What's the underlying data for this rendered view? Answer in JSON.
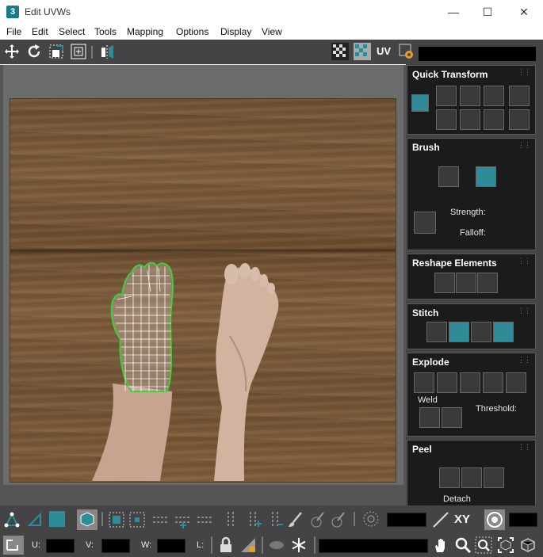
{
  "window": {
    "app_icon_text": "3",
    "title": "Edit UVWs",
    "minimize": "—",
    "maximize": "☐",
    "close": "✕"
  },
  "menu": [
    "File",
    "Edit",
    "Select",
    "Tools",
    "Mapping",
    "Options",
    "Display",
    "View"
  ],
  "toolbar": {
    "uv_label": "UV"
  },
  "panel": {
    "quick_transform": {
      "title": "Quick Transform"
    },
    "brush": {
      "title": "Brush",
      "strength_label": "Strength:",
      "falloff_label": "Falloff:"
    },
    "reshape": {
      "title": "Reshape Elements"
    },
    "stitch": {
      "title": "Stitch"
    },
    "explode": {
      "title": "Explode",
      "weld_label": "Weld",
      "threshold_label": "Threshold:"
    },
    "peel": {
      "title": "Peel",
      "detach_label": "Detach"
    }
  },
  "bottom": {
    "xy_label": "XY",
    "u_label": "U:",
    "v_label": "V:",
    "w_label": "W:",
    "l_label": "L:"
  },
  "colors": {
    "accent_teal": "#2e8c98",
    "uv_wire": "#ffffff",
    "uv_outline": "#3ecf3e",
    "panel_bg": "#1b1b1b",
    "toolbar_bg": "#444446"
  }
}
